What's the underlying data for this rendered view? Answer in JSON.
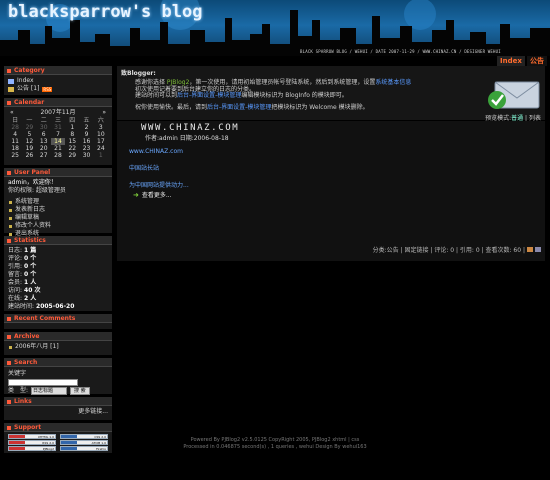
{
  "header": {
    "title": "blacksparrow's blog",
    "strip": "BLACK SPARROW BLOG / WEHUI / DATE 2007-11-29 / WWW.CHINAZ.CN / DESIGNER WEHUI"
  },
  "nav": {
    "index": "Index",
    "guestbook": "公告"
  },
  "sidebar": {
    "category": {
      "title": "Category",
      "items": [
        {
          "label": "Index"
        },
        {
          "label": "公告 [1]",
          "rss": "RSS"
        }
      ]
    },
    "calendar": {
      "title": "Calendar",
      "prev": "«",
      "month": "2007年11月",
      "next": "»",
      "weekdays": [
        "日",
        "一",
        "二",
        "三",
        "四",
        "五",
        "六"
      ],
      "weeks": [
        [
          "28",
          "29",
          "30",
          "31",
          "1",
          "2",
          "3"
        ],
        [
          "4",
          "5",
          "6",
          "7",
          "8",
          "9",
          "10"
        ],
        [
          "11",
          "12",
          "13",
          "14",
          "15",
          "16",
          "17"
        ],
        [
          "18",
          "19",
          "20",
          "21",
          "22",
          "23",
          "24"
        ],
        [
          "25",
          "26",
          "27",
          "28",
          "29",
          "30",
          "1"
        ]
      ]
    },
    "user": {
      "title": "User Panel",
      "greeting": "admin，欢迎你！",
      "role": "你的权限: 超级管理员",
      "links": [
        "系统管理",
        "发表新日志",
        "编辑草稿",
        "修改个人资料",
        "退出系统"
      ]
    },
    "stats": {
      "title": "Statistics",
      "rows": [
        {
          "label": "日志:",
          "value": "1 篇"
        },
        {
          "label": "评论:",
          "value": "0 个"
        },
        {
          "label": "引用:",
          "value": "0 个"
        },
        {
          "label": "留言:",
          "value": "0 个"
        },
        {
          "label": "会员:",
          "value": "1 人"
        },
        {
          "label": "访问:",
          "value": "40 次"
        },
        {
          "label": "在线:",
          "value": "2 人"
        },
        {
          "label": "建站时间:",
          "value": "2005-06-20"
        }
      ]
    },
    "recent_comments": {
      "title": "Recent Comments"
    },
    "archive": {
      "title": "Archive",
      "items": [
        "2006年八月 [1]"
      ]
    },
    "search": {
      "title": "Search",
      "keyword_label": "关键字",
      "scope_label": "类　型:",
      "select_value": "日志标题",
      "button": "搜 索"
    },
    "links": {
      "title": "Links",
      "more": "更多链接..."
    },
    "support": {
      "title": "Support",
      "badges": [
        "XHTML 1.0",
        "CSS 2.0",
        "RSS 2.0",
        "ATOM 1.0",
        "PJBlog2",
        "Firefox"
      ]
    }
  },
  "welcome": {
    "heading": "致Blogger:",
    "line1a": "感谢你选择 ",
    "line1b": "PJBlog2",
    "line1c": "，第一次使用，请用初始管理员帐号登陆系统，然后到系统管理，设置",
    "line1d": "系统基本信息",
    "line2": "初次使用记着要到后台建立你的日志的分类。",
    "line3a": "建站时间可以到",
    "line3b": "后台-界面设置-模块管理",
    "line3c": "编辑模块标识为 BlogInfo 的模块即可。",
    "line4a": "祝你使用愉快。最后，请到",
    "line4b": "后台-界面设置-模块管理",
    "line4c": "把模块标识为 Welcome 模块删除。",
    "view_label": "预览模式:",
    "view_normal": "普通",
    "view_list": "列表"
  },
  "post": {
    "title": "WWW.CHINAZ.COM",
    "meta": "作者:admin 日期:2006-08-18",
    "link": "www.CHINAZ.com",
    "tag": "中国站长站",
    "power": "为中国网站提供动力...",
    "read_more": "查看更多...",
    "foot": "分类:公告 | 固定链接 | 评论: 0 | 引用: 0 | 查看次数: 60 |"
  },
  "footer": {
    "line1": "Powered By PJBlog2 v2.5.0125 CopyRight 2005, PJBlog2 xhtml | css",
    "line2": "Processed in 0.046875 second(s) , 1 queries , wehui Design By wehui163"
  }
}
